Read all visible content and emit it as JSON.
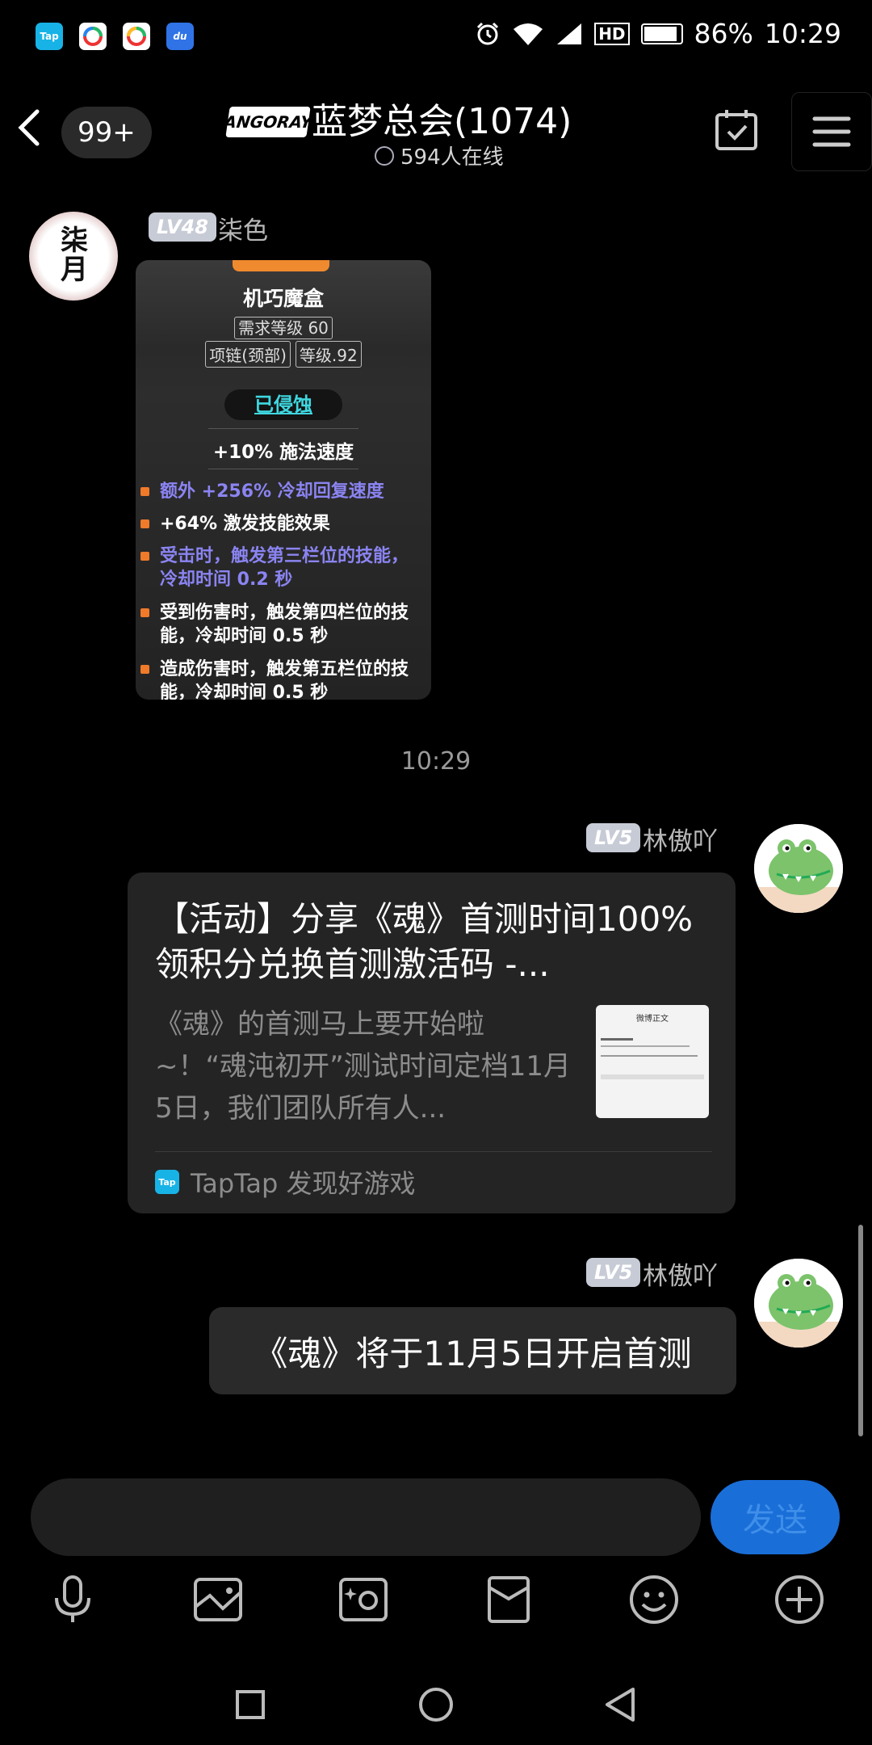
{
  "status_bar": {
    "apps": [
      "Tap",
      "du"
    ],
    "battery": "86%",
    "time": "10:29",
    "network": "HD"
  },
  "header": {
    "unread": "99+",
    "logo_text": "ANGORAY",
    "title": "蓝梦总会(1074)",
    "online": "594人在线"
  },
  "messages": {
    "first": {
      "level": "LV48",
      "sender": "柒色",
      "avatar_text": "柒月",
      "item": {
        "name": "机巧魔盒",
        "requirement": "需求等级 60",
        "slot": "项链(颈部)",
        "item_level": "等级.92",
        "corrupted": "已侵蚀",
        "main_stat": "+10% 施法速度",
        "affixes": [
          {
            "text": "额外 +256% 冷却回复速度",
            "color": "purple"
          },
          {
            "text": "+64% 激发技能效果",
            "color": "white"
          },
          {
            "text": "受击时，触发第三栏位的技能，冷却时间 0.2 秒",
            "color": "purple"
          },
          {
            "text": "受到伤害时，触发第四栏位的技能，冷却时间 0.5 秒",
            "color": "white"
          },
          {
            "text": "造成伤害时，触发第五栏位的技能，冷却时间 0.5 秒",
            "color": "white"
          }
        ]
      }
    },
    "time_divider": "10:29",
    "second": {
      "level": "LV5",
      "sender": "林傲吖",
      "share": {
        "title": "【活动】分享《魂》首测时间100%领积分兑换首测激活码 -...",
        "description": "《魂》的首测马上要开始啦~！“魂沌初开”测试时间定档11月5日，我们团队所有人...",
        "thumb_header": "微博正文",
        "source_icon": "Tap",
        "source": "TapTap 发现好游戏"
      }
    },
    "third": {
      "level": "LV5",
      "sender": "林傲吖",
      "text": "《魂》将于11月5日开启首测"
    }
  },
  "input": {
    "placeholder": "",
    "send_label": "发送"
  },
  "colors": {
    "accent": "#1a6ed8",
    "purple_affix": "#8b84f2",
    "corrupt_cyan": "#3fd7e0"
  }
}
